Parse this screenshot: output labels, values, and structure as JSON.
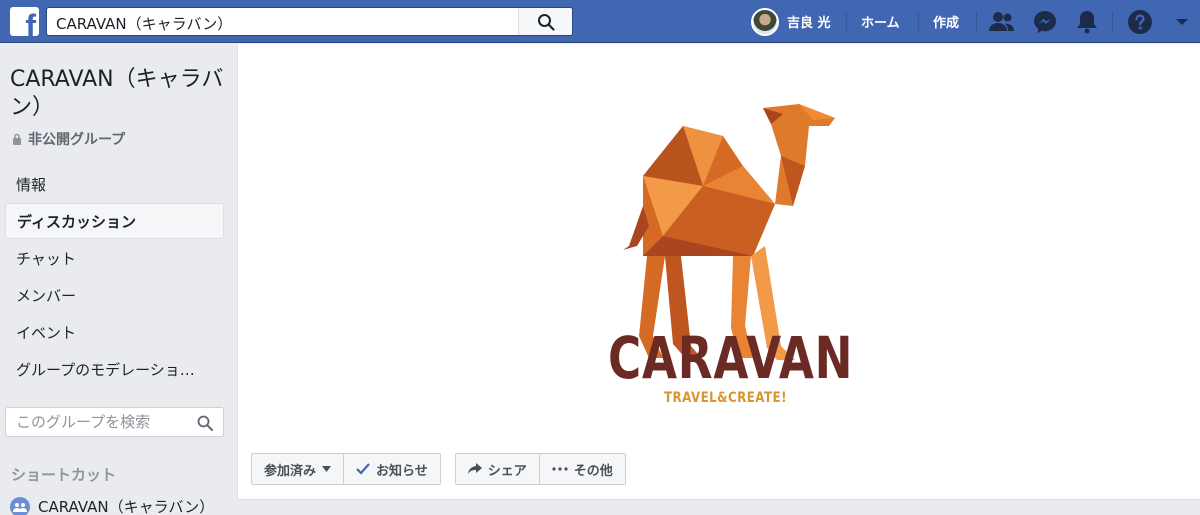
{
  "app": {
    "logo_letter": "f",
    "search_value": "CARAVAN（キャラバン）",
    "user_name": "吉良 光",
    "nav_home": "ホーム",
    "nav_create": "作成"
  },
  "sidebar": {
    "group_name": "CARAVAN（キャラバン）",
    "privacy": "非公開グループ",
    "items": [
      {
        "label": "情報",
        "active": false
      },
      {
        "label": "ディスカッション",
        "active": true
      },
      {
        "label": "チャット",
        "active": false
      },
      {
        "label": "メンバー",
        "active": false
      },
      {
        "label": "イベント",
        "active": false
      },
      {
        "label": "グループのモデレーショ…",
        "active": false
      }
    ],
    "search_placeholder": "このグループを検索",
    "shortcuts_heading": "ショートカット",
    "shortcut_item": "CARAVAN（キャラバン）"
  },
  "cover": {
    "brand_name": "CARAVAN",
    "tagline": "TRAVEL&CREATE!"
  },
  "actions": {
    "joined": "参加済み",
    "notifications": "お知らせ",
    "share": "シェア",
    "more": "その他"
  },
  "colors": {
    "brand_blue": "#4267b2",
    "logo_brown": "#6b2a23",
    "tagline_gold": "#d9952f",
    "camel_orange": "#e2782a"
  }
}
